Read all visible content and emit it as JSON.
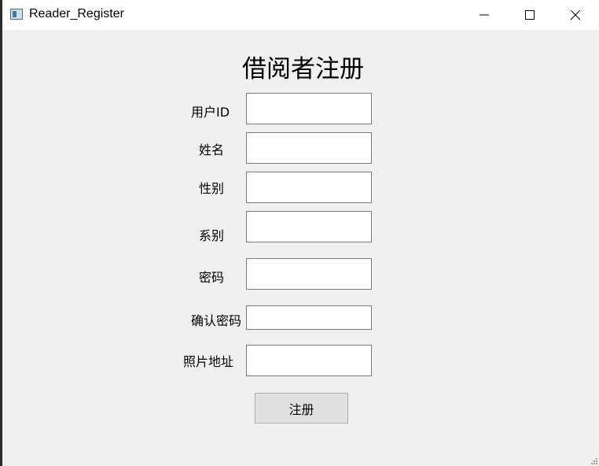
{
  "window": {
    "title": "Reader_Register"
  },
  "form": {
    "heading": "借阅者注册",
    "fields": [
      {
        "label": "用户ID",
        "value": ""
      },
      {
        "label": "姓名",
        "value": ""
      },
      {
        "label": "性别",
        "value": ""
      },
      {
        "label": "系别",
        "value": ""
      },
      {
        "label": "密码",
        "value": ""
      },
      {
        "label": "确认密码",
        "value": ""
      },
      {
        "label": "照片地址",
        "value": ""
      }
    ],
    "submit_label": "注册"
  }
}
